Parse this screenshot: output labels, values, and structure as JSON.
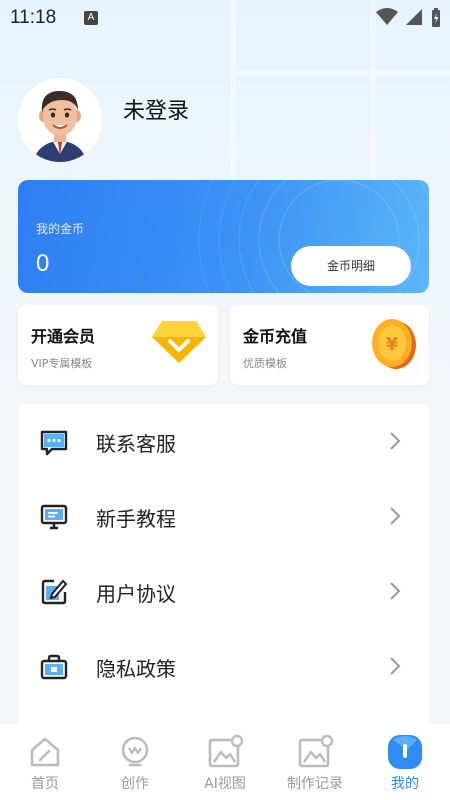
{
  "status_bar": {
    "time": "11:18",
    "icons": [
      "notification-a-icon",
      "wifi-icon",
      "signal-icon",
      "battery-charging-icon"
    ]
  },
  "profile": {
    "avatar_icon": "avatar-man-3d",
    "username": "未登录"
  },
  "coin_card": {
    "label": "我的金币",
    "value": "0",
    "detail_button": "金币明细",
    "colors": {
      "start": "#2e7ef3",
      "end": "#5cb6f9"
    }
  },
  "features": [
    {
      "title": "开通会员",
      "subtitle": "VIP专属模板",
      "icon": "diamond-icon"
    },
    {
      "title": "金币充值",
      "subtitle": "优质模板",
      "icon": "gold-coin-icon"
    }
  ],
  "menu": [
    {
      "label": "联系客服",
      "icon": "chat-bubble-icon"
    },
    {
      "label": "新手教程",
      "icon": "monitor-icon"
    },
    {
      "label": "用户协议",
      "icon": "edit-document-icon"
    },
    {
      "label": "隐私政策",
      "icon": "lock-briefcase-icon"
    }
  ],
  "tab_bar": {
    "active_index": 4,
    "active_color": "#2f8cf4",
    "tabs": [
      {
        "label": "首页",
        "icon": "home-icon"
      },
      {
        "label": "创作",
        "icon": "create-bulb-icon"
      },
      {
        "label": "AI视图",
        "icon": "ai-image-icon"
      },
      {
        "label": "制作记录",
        "icon": "record-image-icon"
      },
      {
        "label": "我的",
        "icon": "profile-icon"
      }
    ]
  }
}
